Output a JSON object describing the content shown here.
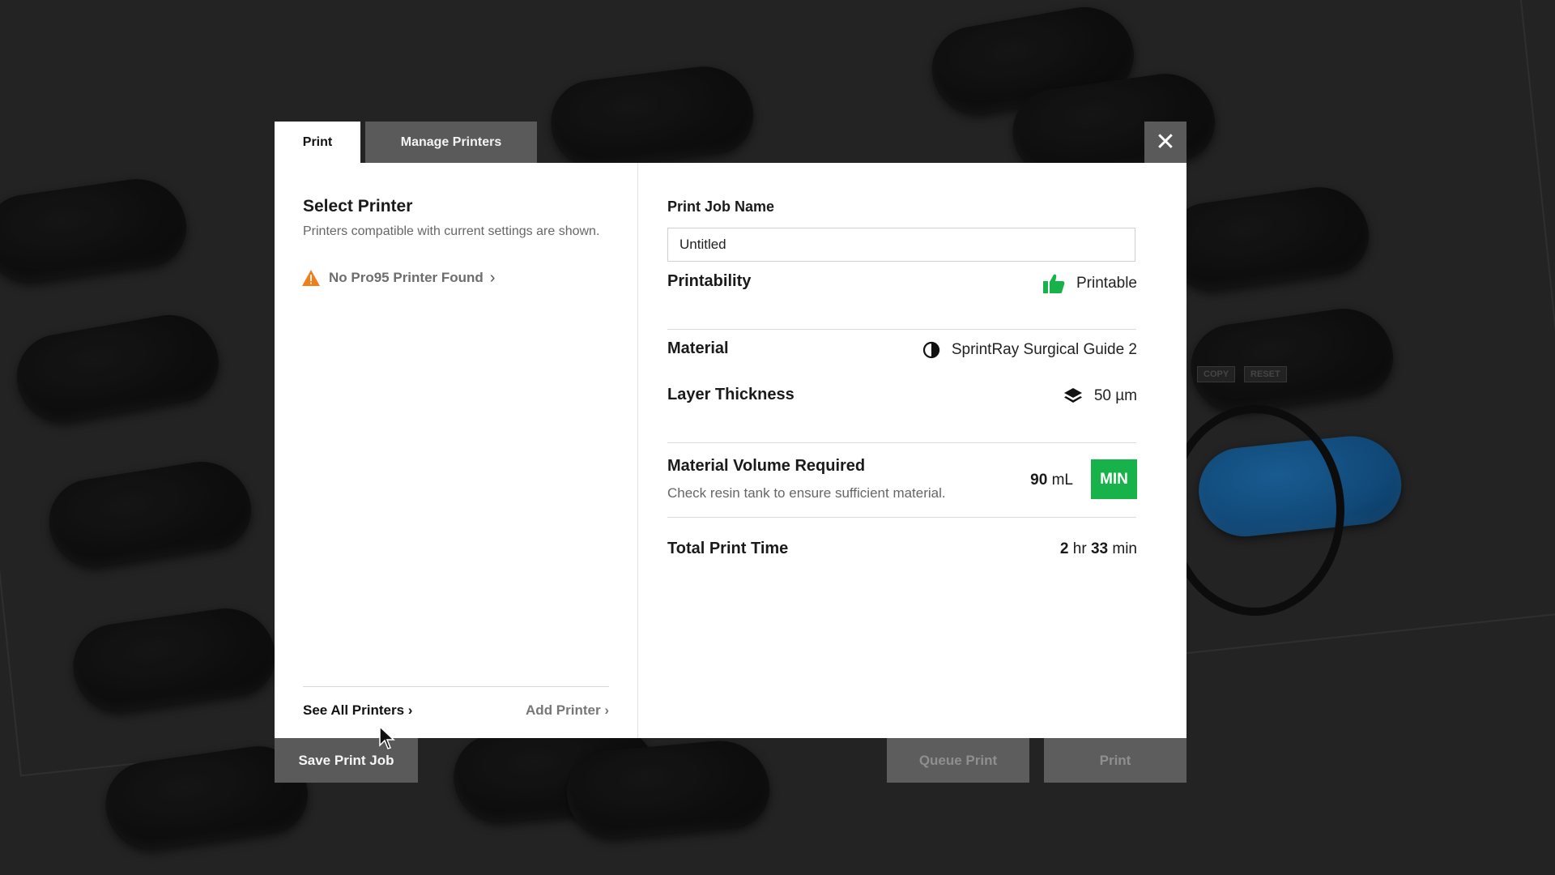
{
  "tabs": {
    "print": "Print",
    "manage_printers": "Manage Printers"
  },
  "close_icon": "close-icon",
  "select_printer": {
    "title": "Select Printer",
    "subtitle": "Printers compatible with current settings are shown.",
    "warning": "No Pro95 Printer Found",
    "see_all": "See All Printers",
    "add_printer": "Add Printer"
  },
  "job": {
    "label": "Print Job Name",
    "value": "Untitled"
  },
  "printability": {
    "label": "Printability",
    "value": "Printable",
    "icon": "thumbs-up-icon",
    "color": "#18b24b"
  },
  "material": {
    "label": "Material",
    "value": "SprintRay Surgical Guide 2",
    "icon": "resin-drop-icon"
  },
  "layer": {
    "label": "Layer Thickness",
    "value": "50 µm",
    "icon": "layers-icon"
  },
  "volume": {
    "label": "Material Volume Required",
    "sub": "Check resin tank to ensure sufficient material.",
    "amount": "90",
    "unit": "mL",
    "badge": "MIN",
    "badge_color": "#18b24b"
  },
  "time": {
    "label": "Total Print Time",
    "hours": "2",
    "hr_unit": "hr",
    "minutes": "33",
    "min_unit": "min"
  },
  "footer": {
    "save": "Save Print Job",
    "queue": "Queue Print",
    "print": "Print"
  },
  "scene": {
    "copy": "COPY",
    "reset": "RESET"
  },
  "colors": {
    "warning": "#f07f1a",
    "accent_green": "#18b24b"
  }
}
